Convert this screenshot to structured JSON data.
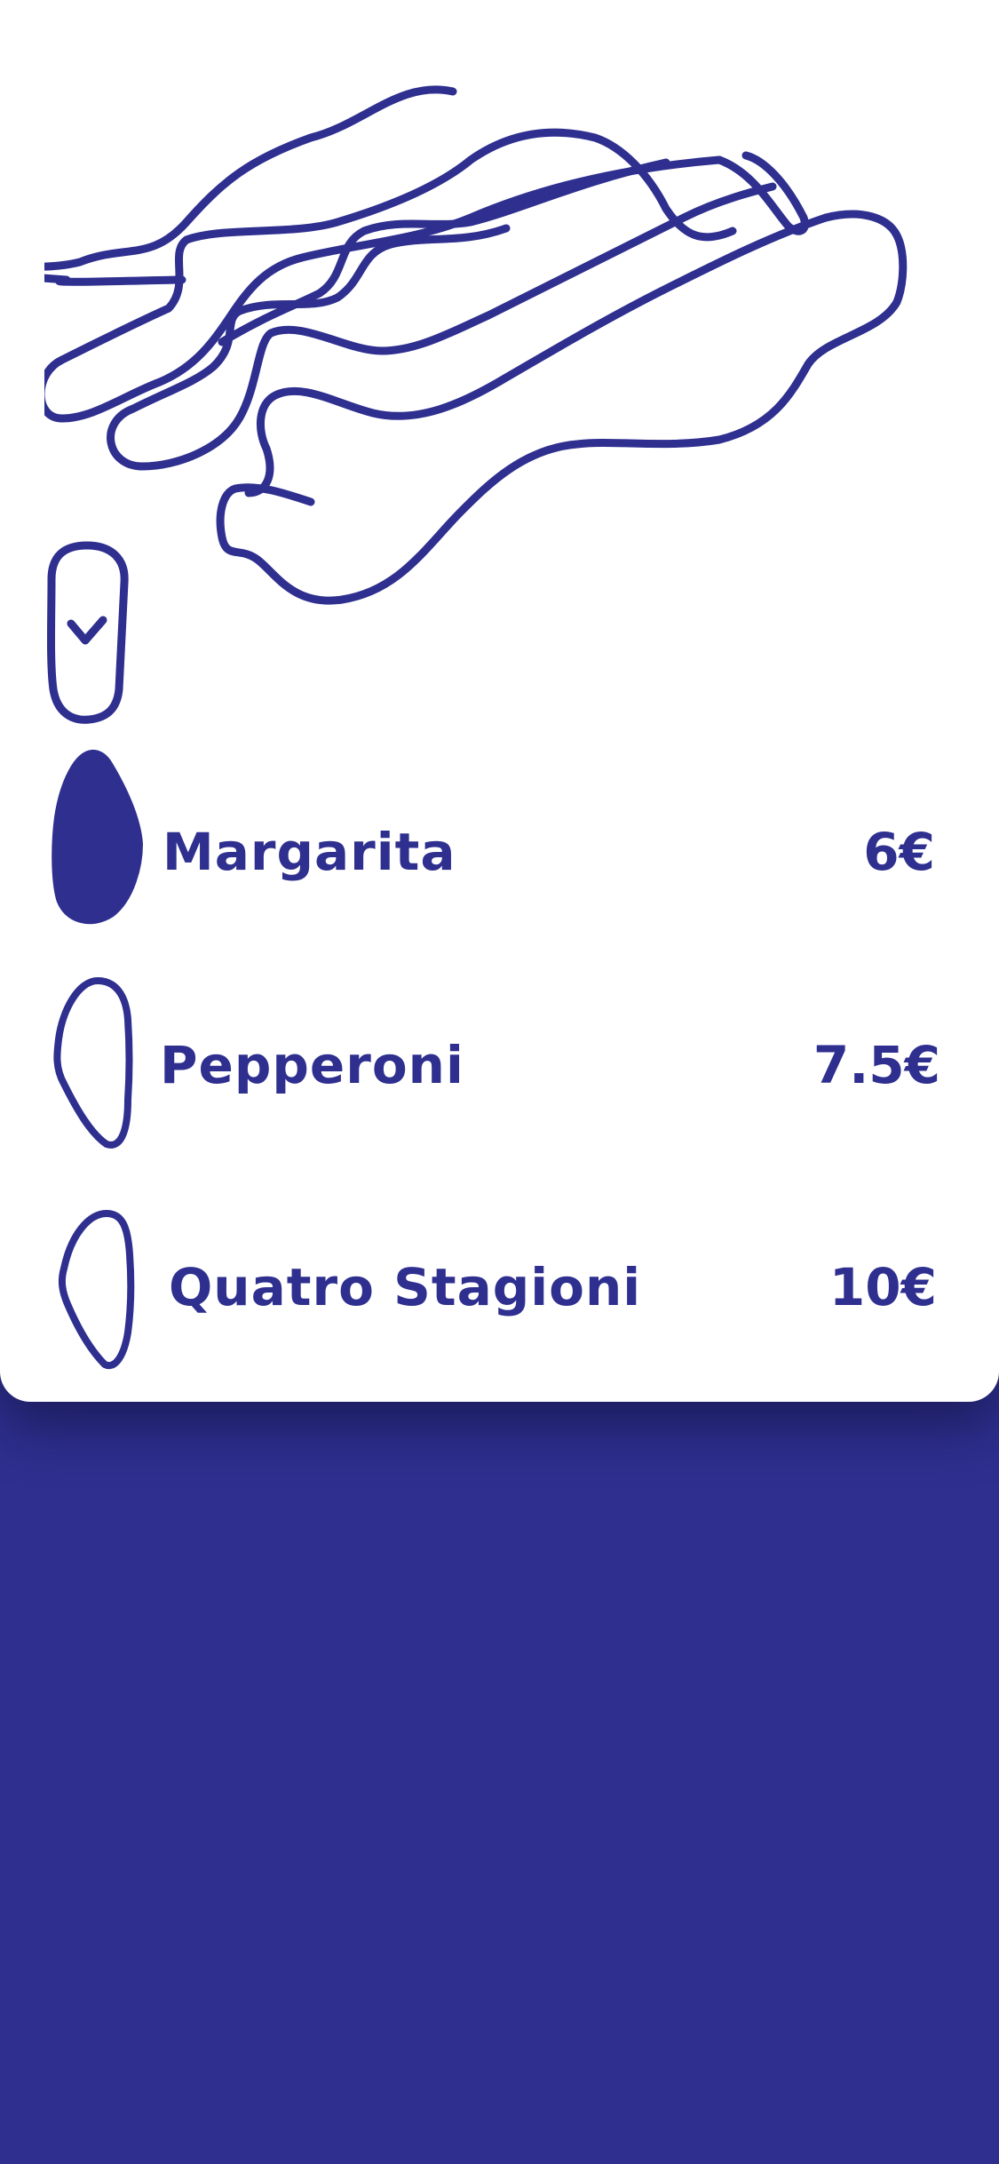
{
  "menu": {
    "items": [
      {
        "name": "Margarita",
        "price": "6€",
        "selected": true
      },
      {
        "name": "Pepperoni",
        "price": "7.5€",
        "selected": false
      },
      {
        "name": "Quatro Stagioni",
        "price": "10€",
        "selected": false
      }
    ]
  },
  "toggle": {
    "checked": true,
    "icon": "checkmark-icon"
  },
  "illustration": {
    "icon": "pizza-slice-illustration"
  },
  "colors": {
    "accent": "#2E2F8F",
    "card": "#FFFFFF"
  }
}
